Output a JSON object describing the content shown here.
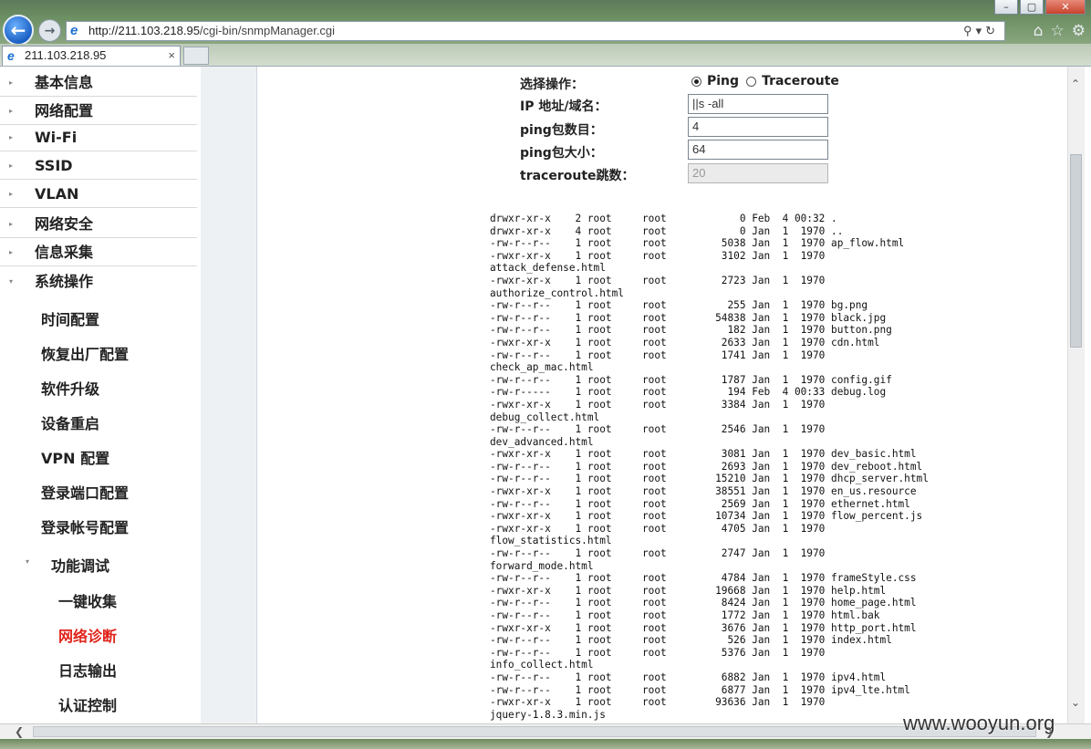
{
  "browser": {
    "url_host": "http://211.103.218.95",
    "url_path": "/cgi-bin/snmpManager.cgi",
    "tab_title": "211.103.218.95",
    "tab_close": "×",
    "addr_tools": "⚲▾↻",
    "back_glyph": "←",
    "fwd_glyph": "→",
    "right_tools": [
      "⌂",
      "☆",
      "⚙"
    ],
    "window_buttons": [
      "–",
      "▢",
      "✕"
    ]
  },
  "sidebar": {
    "top_items": [
      "基本信息",
      "网络配置",
      "Wi-Fi",
      "SSID",
      "VLAN",
      "网络安全",
      "信息采集",
      "系统操作"
    ],
    "sub_items": [
      "时间配置",
      "恢复出厂配置",
      "软件升级",
      "设备重启",
      "VPN 配置",
      "登录端口配置",
      "登录帐号配置"
    ],
    "group": "功能调试",
    "group_items": [
      "一键收集",
      "网络诊断",
      "日志输出",
      "认证控制"
    ],
    "active": "网络诊断"
  },
  "form": {
    "operation_label": "选择操作：",
    "ping_label": "Ping",
    "traceroute_label": "Traceroute",
    "selected": "Ping",
    "host_label": "IP 地址/域名：",
    "host_value": "||s -all",
    "count_label": "ping包数目：",
    "count_value": "4",
    "size_label": "ping包大小：",
    "size_value": "64",
    "hops_label": "traceroute跳数：",
    "hops_value": "20"
  },
  "output_lines": [
    "drwxr-xr-x    2 root     root            0 Feb  4 00:32 .",
    "drwxr-xr-x    4 root     root            0 Jan  1  1970 ..",
    "-rw-r--r--    1 root     root         5038 Jan  1  1970 ap_flow.html",
    "-rwxr-xr-x    1 root     root         3102 Jan  1  1970",
    "attack_defense.html",
    "-rwxr-xr-x    1 root     root         2723 Jan  1  1970",
    "authorize_control.html",
    "-rw-r--r--    1 root     root          255 Jan  1  1970 bg.png",
    "-rw-r--r--    1 root     root        54838 Jan  1  1970 black.jpg",
    "-rw-r--r--    1 root     root          182 Jan  1  1970 button.png",
    "-rwxr-xr-x    1 root     root         2633 Jan  1  1970 cdn.html",
    "-rw-r--r--    1 root     root         1741 Jan  1  1970",
    "check_ap_mac.html",
    "-rw-r--r--    1 root     root         1787 Jan  1  1970 config.gif",
    "-rw-r-----    1 root     root          194 Feb  4 00:33 debug.log",
    "-rwxr-xr-x    1 root     root         3384 Jan  1  1970",
    "debug_collect.html",
    "-rw-r--r--    1 root     root         2546 Jan  1  1970",
    "dev_advanced.html",
    "-rwxr-xr-x    1 root     root         3081 Jan  1  1970 dev_basic.html",
    "-rw-r--r--    1 root     root         2693 Jan  1  1970 dev_reboot.html",
    "-rw-r--r--    1 root     root        15210 Jan  1  1970 dhcp_server.html",
    "-rwxr-xr-x    1 root     root        38551 Jan  1  1970 en_us.resource",
    "-rw-r--r--    1 root     root         2569 Jan  1  1970 ethernet.html",
    "-rwxr-xr-x    1 root     root        10734 Jan  1  1970 flow_percent.js",
    "-rwxr-xr-x    1 root     root         4705 Jan  1  1970",
    "flow_statistics.html",
    "-rw-r--r--    1 root     root         2747 Jan  1  1970",
    "forward_mode.html",
    "-rw-r--r--    1 root     root         4784 Jan  1  1970 frameStyle.css",
    "-rwxr-xr-x    1 root     root        19668 Jan  1  1970 help.html",
    "-rw-r--r--    1 root     root         8424 Jan  1  1970 home_page.html",
    "-rw-r--r--    1 root     root         1772 Jan  1  1970 html.bak",
    "-rwxr-xr-x    1 root     root         3676 Jan  1  1970 http_port.html",
    "-rw-r--r--    1 root     root          526 Jan  1  1970 index.html",
    "-rw-r--r--    1 root     root         5376 Jan  1  1970",
    "info_collect.html",
    "-rw-r--r--    1 root     root         6882 Jan  1  1970 ipv4.html",
    "-rw-r--r--    1 root     root         6877 Jan  1  1970 ipv4_lte.html",
    "-rwxr-xr-x    1 root     root        93636 Jan  1  1970",
    "jquery-1.8.3.min.js"
  ],
  "watermark": "www.wooyun.org",
  "colors": {
    "active_menu": "#e0231a",
    "text": "#222222"
  }
}
